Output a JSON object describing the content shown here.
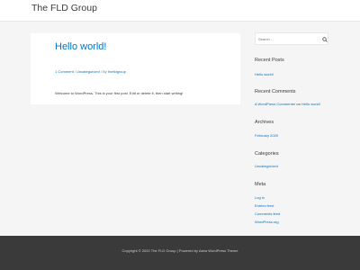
{
  "site": {
    "title": "The FLD Group"
  },
  "post": {
    "title": "Hello world!",
    "meta": {
      "comments": "1 Comment",
      "category": "Uncategorized",
      "by": "By",
      "author": "thefldgroup"
    },
    "excerpt": "Welcome to WordPress. This is your first post. Edit or delete it, then start writing!"
  },
  "sidebar": {
    "search": {
      "placeholder": "Search ...",
      "icon": "search-icon"
    },
    "recent_posts": {
      "title": "Recent Posts",
      "items": [
        "Hello world!"
      ]
    },
    "recent_comments": {
      "title": "Recent Comments",
      "commenter": "A WordPress Commenter",
      "on": "on",
      "post": "Hello world!"
    },
    "archives": {
      "title": "Archives",
      "items": [
        "February 2020"
      ]
    },
    "categories": {
      "title": "Categories",
      "items": [
        "Uncategorized"
      ]
    },
    "meta": {
      "title": "Meta",
      "items": [
        "Log in",
        "Entries feed",
        "Comments feed",
        "WordPress.org"
      ]
    }
  },
  "footer": {
    "text": "Copyright © 2020 The FLD Group | Powered by Astra WordPress Theme"
  },
  "colors": {
    "link": "#0274be",
    "text": "#3a3a3a",
    "background": "#f5f5f5",
    "footer": "#3a3a3a"
  }
}
